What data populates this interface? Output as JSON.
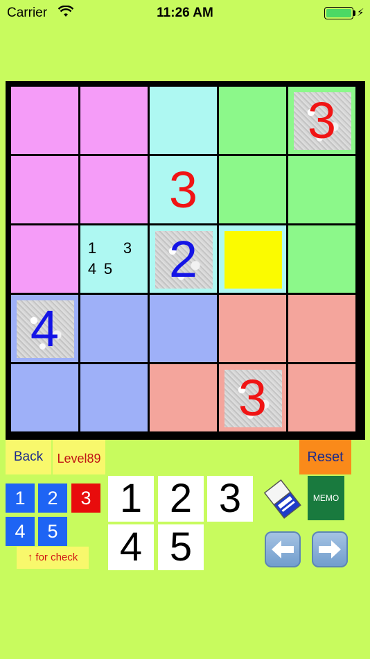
{
  "status_bar": {
    "carrier": "Carrier",
    "time": "11:26 AM"
  },
  "board": {
    "rows": [
      [
        {
          "color": "pink",
          "value": ""
        },
        {
          "color": "pink",
          "value": ""
        },
        {
          "color": "cyan",
          "value": ""
        },
        {
          "color": "green",
          "value": ""
        },
        {
          "color": "green",
          "value": "3",
          "given": true,
          "digit_color": "red"
        }
      ],
      [
        {
          "color": "pink",
          "value": ""
        },
        {
          "color": "pink",
          "value": ""
        },
        {
          "color": "cyan",
          "value": "3",
          "given": false,
          "digit_color": "red"
        },
        {
          "color": "green",
          "value": ""
        },
        {
          "color": "green",
          "value": ""
        }
      ],
      [
        {
          "color": "pink",
          "value": ""
        },
        {
          "color": "cyan",
          "value": "",
          "memo": [
            "1",
            "",
            "3",
            "4",
            "5"
          ]
        },
        {
          "color": "cyan",
          "value": "2",
          "given": true,
          "digit_color": "blue"
        },
        {
          "color": "cyan",
          "value": "",
          "selected": true
        },
        {
          "color": "green",
          "value": ""
        }
      ],
      [
        {
          "color": "blue",
          "value": "4",
          "given": true,
          "digit_color": "blue"
        },
        {
          "color": "blue",
          "value": ""
        },
        {
          "color": "blue",
          "value": ""
        },
        {
          "color": "salmon",
          "value": ""
        },
        {
          "color": "salmon",
          "value": ""
        }
      ],
      [
        {
          "color": "blue",
          "value": ""
        },
        {
          "color": "blue",
          "value": ""
        },
        {
          "color": "salmon",
          "value": ""
        },
        {
          "color": "salmon",
          "value": "3",
          "given": true,
          "digit_color": "red"
        },
        {
          "color": "salmon",
          "value": ""
        }
      ]
    ]
  },
  "controls": {
    "back_label": "Back",
    "level_label": "Level89",
    "reset_label": "Reset",
    "check_label": "↑ for check",
    "memo_label": "MEMO",
    "small_numbers": [
      "1",
      "2",
      "3",
      "4",
      "5"
    ],
    "small_selected": "3",
    "big_numbers": [
      "1",
      "2",
      "3",
      "4",
      "5"
    ],
    "eraser_icon": "eraser-icon",
    "left_icon": "left-arrow-icon",
    "right_icon": "right-arrow-icon"
  },
  "colors": {
    "background": "#c8fb5e",
    "pink": "#f59cf8",
    "cyan": "#aef8f2",
    "green": "#8cf88a",
    "blue": "#9eb0f8",
    "salmon": "#f4a59c",
    "selected": "#fbfb00",
    "digit_red": "#f01414",
    "digit_blue": "#1414e6"
  }
}
